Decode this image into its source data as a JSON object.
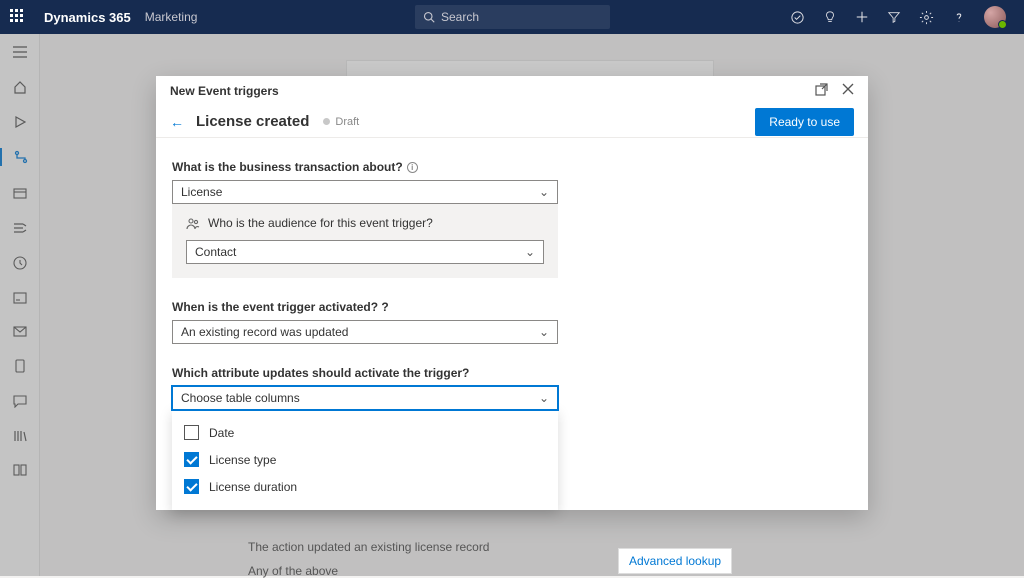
{
  "topbar": {
    "brand": "Dynamics 365",
    "module": "Marketing",
    "search_placeholder": "Search"
  },
  "modal": {
    "title": "New Event triggers",
    "heading": "License created",
    "status": "Draft",
    "ready_button": "Ready to use",
    "q1_label": "What is the business transaction about?",
    "q1_value": "License",
    "audience_label": "Who is the audience for this event trigger?",
    "audience_value": "Contact",
    "q2_label": "When is the event trigger activated? ?",
    "q2_value": "An existing record was updated",
    "q3_label": "Which attribute updates should activate the trigger?",
    "q3_value": "Choose table columns",
    "options": [
      {
        "label": "Date",
        "checked": false
      },
      {
        "label": "License type",
        "checked": true
      },
      {
        "label": "License duration",
        "checked": true
      }
    ]
  },
  "background": {
    "line1": "The action updated an existing license record",
    "line2": "Any of the above",
    "advanced": "Advanced lookup"
  }
}
